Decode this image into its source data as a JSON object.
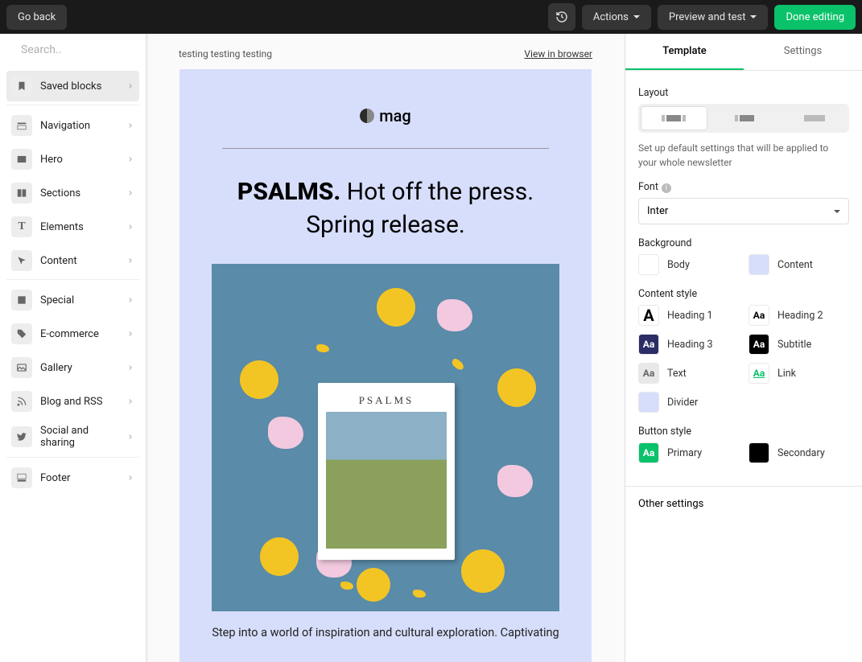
{
  "topbar": {
    "go_back": "Go back",
    "actions": "Actions",
    "preview": "Preview and test",
    "done": "Done editing"
  },
  "search": {
    "placeholder": "Search.."
  },
  "sidebar": {
    "g1": [
      {
        "label": "Saved blocks",
        "icon": "bookmark",
        "active": true
      }
    ],
    "g2": [
      {
        "label": "Navigation",
        "icon": "nav"
      },
      {
        "label": "Hero",
        "icon": "hero"
      },
      {
        "label": "Sections",
        "icon": "sections"
      },
      {
        "label": "Elements",
        "icon": "text"
      },
      {
        "label": "Content",
        "icon": "cursor"
      }
    ],
    "g3": [
      {
        "label": "Special",
        "icon": "special"
      },
      {
        "label": "E-commerce",
        "icon": "tag"
      },
      {
        "label": "Gallery",
        "icon": "image"
      },
      {
        "label": "Blog and RSS",
        "icon": "rss"
      },
      {
        "label": "Social and sharing",
        "icon": "twitter"
      }
    ],
    "g4": [
      {
        "label": "Footer",
        "icon": "footer"
      }
    ]
  },
  "editor": {
    "preheader": "testing testing testing",
    "view_browser": "View in browser",
    "logo_text": "mag",
    "headline_bold": "PSALMS.",
    "headline_rest": " Hot off the press. Spring release.",
    "book_title": "PSALMS",
    "body": "Step into a world of inspiration and cultural exploration. Captivating"
  },
  "rpanel": {
    "tabs": {
      "template": "Template",
      "settings": "Settings"
    },
    "layout_label": "Layout",
    "layout_help": "Set up default settings that will be applied to your whole newsletter",
    "font_label": "Font",
    "font_value": "Inter",
    "bg_label": "Background",
    "bg_items": [
      {
        "label": "Body",
        "color": "#ffffff"
      },
      {
        "label": "Content",
        "color": "#d7defb"
      }
    ],
    "cs_label": "Content style",
    "cs_items": [
      {
        "label": "Heading 1",
        "glyph": "A",
        "bg": "#ffffff",
        "fg": "#000",
        "fs": "20px"
      },
      {
        "label": "Heading 2",
        "glyph": "Aa",
        "bg": "#ffffff",
        "fg": "#000"
      },
      {
        "label": "Heading 3",
        "glyph": "Aa",
        "bg": "#2c2c66",
        "fg": "#fff"
      },
      {
        "label": "Subtitle",
        "glyph": "Aa",
        "bg": "#000000",
        "fg": "#fff"
      },
      {
        "label": "Text",
        "glyph": "Aa",
        "bg": "#e8e8e8",
        "fg": "#666"
      },
      {
        "label": "Link",
        "glyph": "Aa",
        "bg": "#ffffff",
        "fg": "#09c269",
        "underline": true
      },
      {
        "label": "Divider",
        "glyph": "",
        "bg": "#d7defb",
        "fg": "#000"
      }
    ],
    "btn_label": "Button style",
    "btn_items": [
      {
        "label": "Primary",
        "glyph": "Aa",
        "bg": "#09c269",
        "fg": "#fff"
      },
      {
        "label": "Secondary",
        "glyph": "",
        "bg": "#000000",
        "fg": "#fff"
      }
    ],
    "other": "Other settings"
  }
}
